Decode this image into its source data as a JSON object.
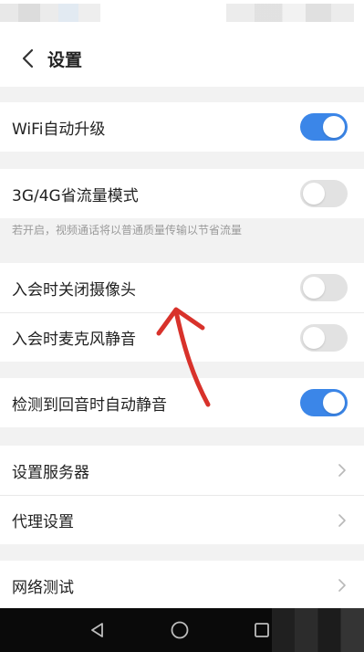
{
  "header": {
    "title": "设置"
  },
  "settings": {
    "wifi_upgrade": {
      "label": "WiFi自动升级",
      "enabled": true
    },
    "data_saver": {
      "label": "3G/4G省流量模式",
      "enabled": false,
      "hint": "若开启，视频通话将以普通质量传输以节省流量"
    },
    "camera_off_on_join": {
      "label": "入会时关闭摄像头",
      "enabled": false
    },
    "mic_mute_on_join": {
      "label": "入会时麦克风静音",
      "enabled": false
    },
    "auto_mute_echo": {
      "label": "检测到回音时自动静音",
      "enabled": true
    },
    "server_settings": {
      "label": "设置服务器"
    },
    "proxy_settings": {
      "label": "代理设置"
    },
    "network_test": {
      "label": "网络测试"
    }
  },
  "colors": {
    "toggle_on": "#3b86e8",
    "toggle_off": "#e2e2e2",
    "annotation_arrow": "#d8322b"
  },
  "icons": {
    "back": "back-arrow-icon",
    "chevron": "chevron-right-icon",
    "nav_back": "triangle-back-icon",
    "nav_home": "circle-home-icon",
    "nav_recent": "square-recent-icon"
  }
}
